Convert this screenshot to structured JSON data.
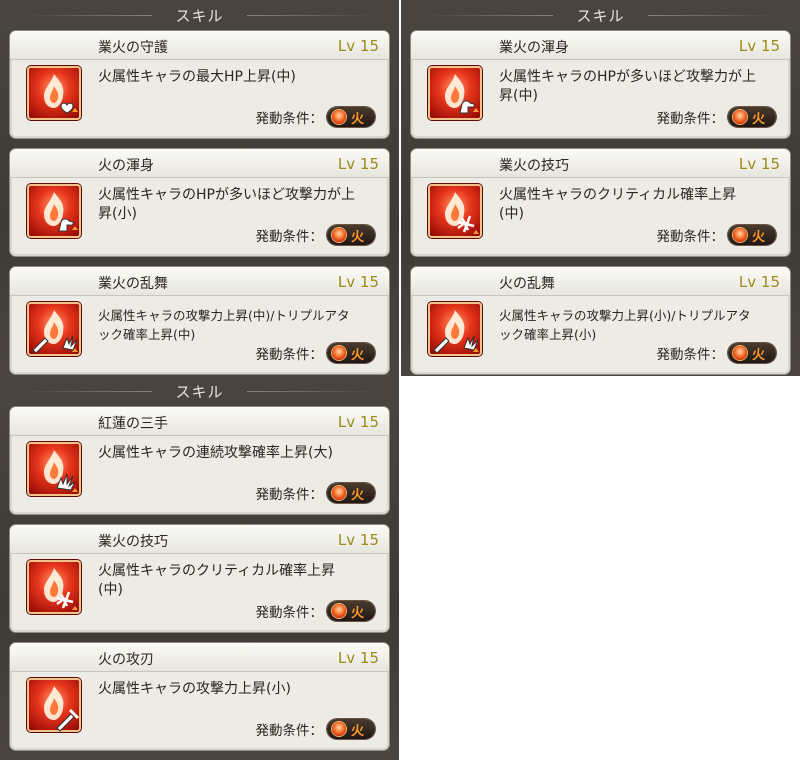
{
  "panels": [
    {
      "title": "スキル",
      "skills": [
        {
          "name": "業火の守護",
          "level": "Lv 15",
          "desc": "火属性キャラの最大HP上昇(中)",
          "cond_label": "発動条件：",
          "cond_value": "火",
          "icon": "flame-heart-icon"
        },
        {
          "name": "火の渾身",
          "level": "Lv 15",
          "desc": "火属性キャラのHPが多いほど攻撃力が上昇(小)",
          "cond_label": "発動条件：",
          "cond_value": "火",
          "icon": "flame-arm-icon"
        },
        {
          "name": "業火の乱舞",
          "level": "Lv 15",
          "desc": "火属性キャラの攻撃力上昇(中)/トリプルアタック確率上昇(中)",
          "cond_label": "発動条件：",
          "cond_value": "火",
          "icon": "flame-sword-sparks-icon"
        }
      ]
    },
    {
      "title": "スキル",
      "skills": [
        {
          "name": "業火の渾身",
          "level": "Lv 15",
          "desc": "火属性キャラのHPが多いほど攻撃力が上昇(中)",
          "cond_label": "発動条件：",
          "cond_value": "火",
          "icon": "flame-arm-icon"
        },
        {
          "name": "業火の技巧",
          "level": "Lv 15",
          "desc": "火属性キャラのクリティカル確率上昇(中)",
          "cond_label": "発動条件：",
          "cond_value": "火",
          "icon": "flame-critical-icon"
        },
        {
          "name": "火の乱舞",
          "level": "Lv 15",
          "desc": "火属性キャラの攻撃力上昇(小)/トリプルアタック確率上昇(小)",
          "cond_label": "発動条件：",
          "cond_value": "火",
          "icon": "flame-sword-sparks-icon"
        }
      ]
    },
    {
      "title": "スキル",
      "skills": [
        {
          "name": "紅蓮の三手",
          "level": "Lv 15",
          "desc": "火属性キャラの連続攻撃確率上昇(大)",
          "cond_label": "発動条件：",
          "cond_value": "火",
          "icon": "flame-sparks-icon"
        },
        {
          "name": "業火の技巧",
          "level": "Lv 15",
          "desc": "火属性キャラのクリティカル確率上昇(中)",
          "cond_label": "発動条件：",
          "cond_value": "火",
          "icon": "flame-critical-icon"
        },
        {
          "name": "火の攻刃",
          "level": "Lv 15",
          "desc": "火属性キャラの攻撃力上昇(小)",
          "cond_label": "発動条件：",
          "cond_value": "火",
          "icon": "flame-sword-icon"
        }
      ]
    }
  ]
}
